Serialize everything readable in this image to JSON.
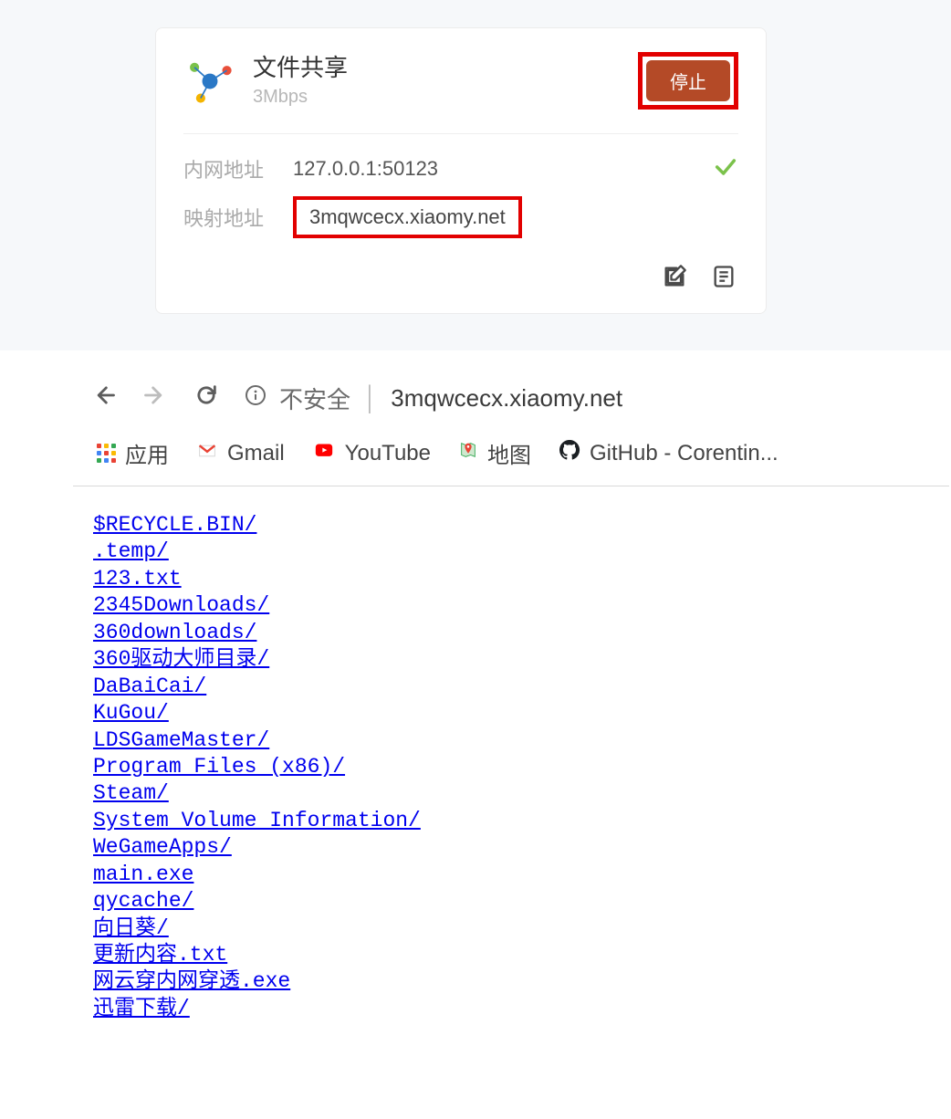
{
  "card": {
    "title": "文件共享",
    "subtitle": "3Mbps",
    "stop_label": "停止",
    "internal_label": "内网地址",
    "internal_value": "127.0.0.1:50123",
    "mapped_label": "映射地址",
    "mapped_value": "3mqwcecx.xiaomy.net"
  },
  "browser": {
    "insecure_label": "不安全",
    "host": "3mqwcecx.xiaomy.net",
    "bookmarks": {
      "apps": "应用",
      "gmail": "Gmail",
      "youtube": "YouTube",
      "maps": "地图",
      "github": "GitHub - Corentin..."
    }
  },
  "files": [
    "$RECYCLE.BIN/",
    ".temp/",
    "123.txt",
    "2345Downloads/",
    "360downloads/",
    "360驱动大师目录/",
    "DaBaiCai/",
    "KuGou/",
    "LDSGameMaster/",
    "Program Files (x86)/",
    "Steam/",
    "System Volume Information/",
    "WeGameApps/",
    "main.exe",
    "qycache/",
    "向日葵/",
    "更新内容.txt",
    "网云穿内网穿透.exe",
    "迅雷下载/"
  ]
}
